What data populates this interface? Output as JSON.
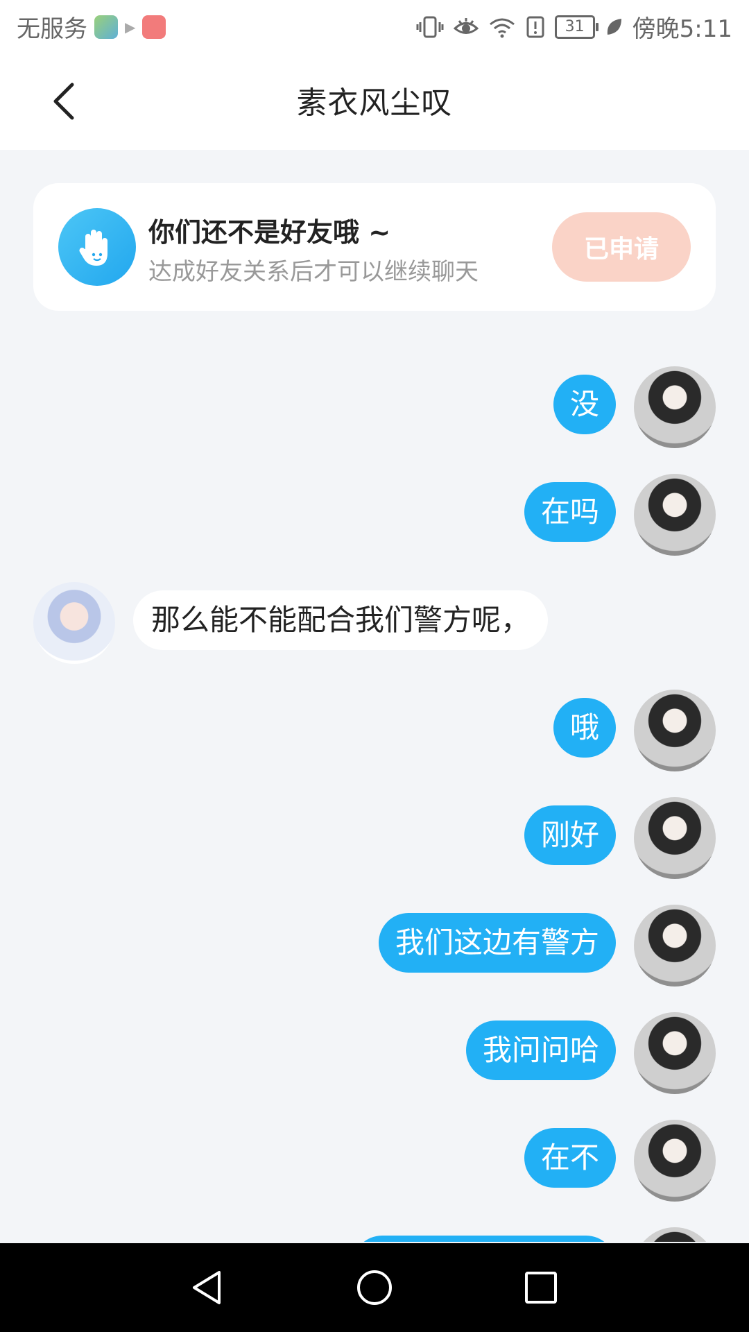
{
  "status_bar": {
    "carrier": "无服务",
    "battery": "31",
    "time": "傍晚5:11"
  },
  "header": {
    "title": "素衣风尘叹"
  },
  "friend_notice": {
    "title": "你们还不是好友哦 ~",
    "subtitle": "达成好友关系后才可以继续聊天",
    "button_label": "已申请"
  },
  "messages": [
    {
      "from": "me",
      "text": "没"
    },
    {
      "from": "me",
      "text": "在吗"
    },
    {
      "from": "peer",
      "text": "那么能不能配合我们警方呢，"
    },
    {
      "from": "me",
      "text": "哦"
    },
    {
      "from": "me",
      "text": "刚好"
    },
    {
      "from": "me",
      "text": "我们这边有警方"
    },
    {
      "from": "me",
      "text": "我问问哈"
    },
    {
      "from": "me",
      "text": "在不"
    }
  ],
  "colors": {
    "my_bubble": "#22b0f5",
    "peer_bubble": "#ffffff",
    "applied_button": "#fad3c7",
    "background": "#f3f5f8"
  }
}
